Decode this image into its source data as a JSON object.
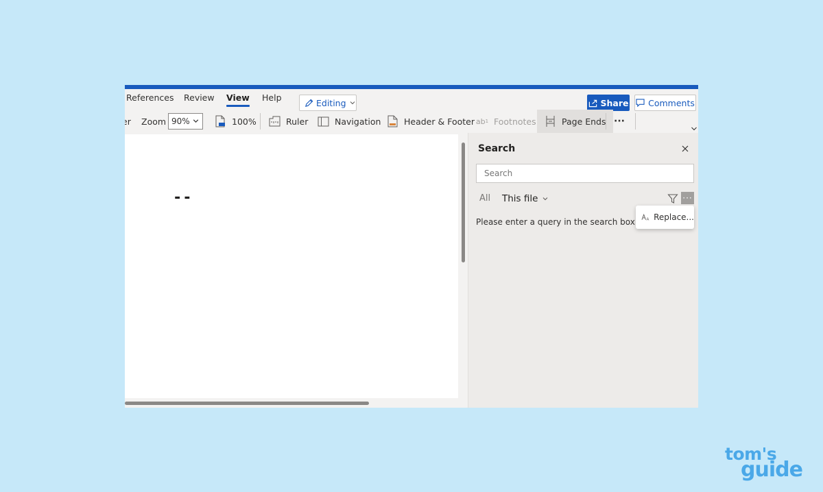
{
  "tabs": [
    {
      "label": "References"
    },
    {
      "label": "Review"
    },
    {
      "label": "View",
      "active": true
    },
    {
      "label": "Help"
    }
  ],
  "editing_label": "Editing",
  "share_label": "Share",
  "comments_label": "Comments",
  "ribbon": {
    "cut_label": "er",
    "zoom_label": "Zoom",
    "zoom_value": "90%",
    "hundred_label": "100%",
    "ruler_label": "Ruler",
    "navigation_label": "Navigation",
    "header_footer_label": "Header & Footer",
    "footnotes_label": "Footnotes",
    "page_ends_label": "Page Ends",
    "more_label": "···"
  },
  "document": {
    "text": "--"
  },
  "search_pane": {
    "title": "Search",
    "input_placeholder": "Search",
    "scope_all": "All",
    "scope_file": "This file",
    "more_label": "···",
    "empty_message": "Please enter a query in the search box.",
    "replace_label": "Replace..."
  },
  "watermark": {
    "line1": "tom's",
    "line2": "guide"
  },
  "colors": {
    "accent": "#185abd",
    "background": "#c6e8f9",
    "logo": "#4aa8e8"
  }
}
